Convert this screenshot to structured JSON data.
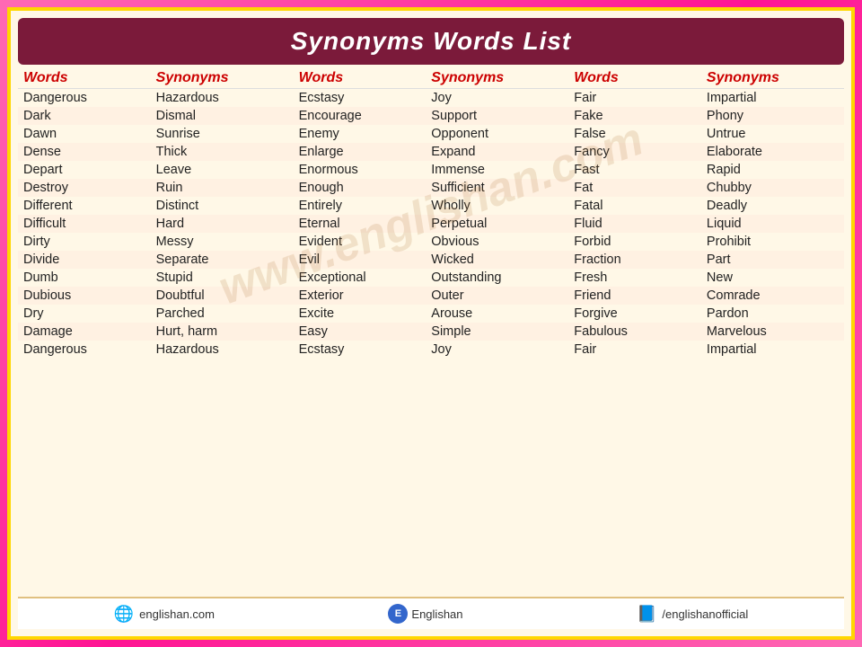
{
  "title": "Synonyms Words List",
  "columns": [
    {
      "header": "Words",
      "key": "word1"
    },
    {
      "header": "Synonyms",
      "key": "syn1"
    },
    {
      "header": "Words",
      "key": "word2"
    },
    {
      "header": "Synonyms",
      "key": "syn2"
    },
    {
      "header": "Words",
      "key": "word3"
    },
    {
      "header": "Synonyms",
      "key": "syn3"
    }
  ],
  "rows": [
    {
      "word1": "Dangerous",
      "syn1": "Hazardous",
      "word2": "Ecstasy",
      "syn2": "Joy",
      "word3": "Fair",
      "syn3": "Impartial"
    },
    {
      "word1": "Dark",
      "syn1": "Dismal",
      "word2": "Encourage",
      "syn2": "Support",
      "word3": "Fake",
      "syn3": "Phony"
    },
    {
      "word1": "Dawn",
      "syn1": "Sunrise",
      "word2": "Enemy",
      "syn2": "Opponent",
      "word3": "False",
      "syn3": "Untrue"
    },
    {
      "word1": "Dense",
      "syn1": "Thick",
      "word2": "Enlarge",
      "syn2": "Expand",
      "word3": "Fancy",
      "syn3": "Elaborate"
    },
    {
      "word1": "Depart",
      "syn1": "Leave",
      "word2": "Enormous",
      "syn2": "Immense",
      "word3": "Fast",
      "syn3": "Rapid"
    },
    {
      "word1": "Destroy",
      "syn1": "Ruin",
      "word2": "Enough",
      "syn2": "Sufficient",
      "word3": "Fat",
      "syn3": "Chubby"
    },
    {
      "word1": "Different",
      "syn1": "Distinct",
      "word2": "Entirely",
      "syn2": "Wholly",
      "word3": "Fatal",
      "syn3": "Deadly"
    },
    {
      "word1": "Difficult",
      "syn1": "Hard",
      "word2": "Eternal",
      "syn2": "Perpetual",
      "word3": "Fluid",
      "syn3": "Liquid"
    },
    {
      "word1": "Dirty",
      "syn1": "Messy",
      "word2": "Evident",
      "syn2": "Obvious",
      "word3": "Forbid",
      "syn3": "Prohibit"
    },
    {
      "word1": "Divide",
      "syn1": "Separate",
      "word2": "Evil",
      "syn2": "Wicked",
      "word3": "Fraction",
      "syn3": "Part"
    },
    {
      "word1": "Dumb",
      "syn1": "Stupid",
      "word2": "Exceptional",
      "syn2": "Outstanding",
      "word3": "Fresh",
      "syn3": "New"
    },
    {
      "word1": "Dubious",
      "syn1": "Doubtful",
      "word2": "Exterior",
      "syn2": "Outer",
      "word3": "Friend",
      "syn3": "Comrade"
    },
    {
      "word1": "Dry",
      "syn1": "Parched",
      "word2": "Excite",
      "syn2": "Arouse",
      "word3": "Forgive",
      "syn3": "Pardon"
    },
    {
      "word1": "Damage",
      "syn1": "Hurt, harm",
      "word2": "Easy",
      "syn2": "Simple",
      "word3": "Fabulous",
      "syn3": "Marvelous"
    },
    {
      "word1": "Dangerous",
      "syn1": "Hazardous",
      "word2": "Ecstasy",
      "syn2": "Joy",
      "word3": "Fair",
      "syn3": "Impartial"
    }
  ],
  "footer": {
    "website": "englishan.com",
    "brand": "Englishan",
    "facebook": "/englishanofficial"
  },
  "watermark": "www.englishan.com"
}
